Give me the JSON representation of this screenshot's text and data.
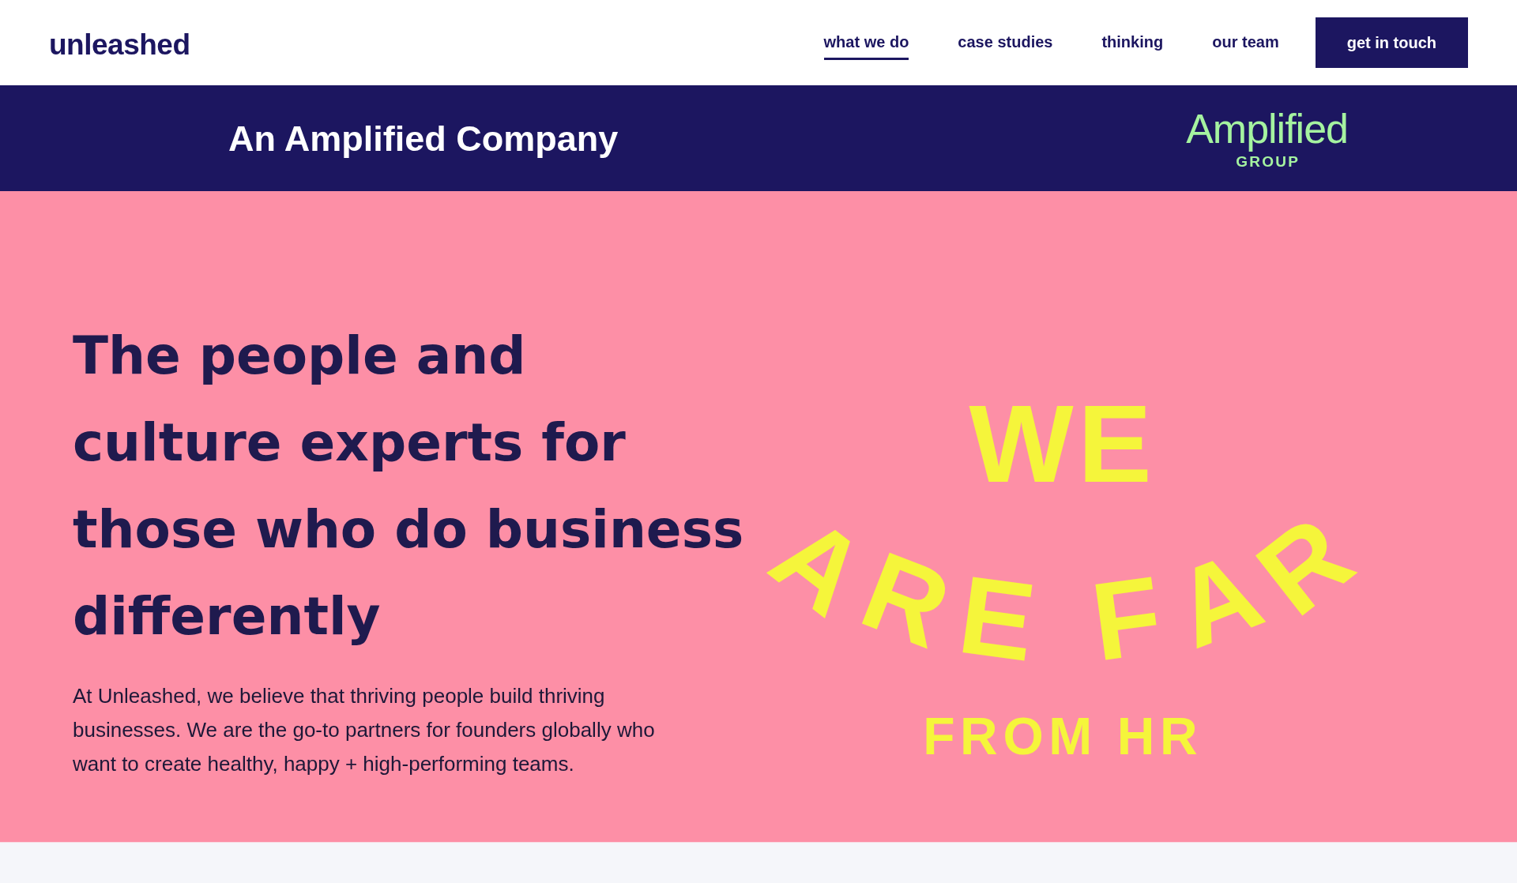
{
  "header": {
    "logo": "unleashed",
    "nav": [
      {
        "label": "what we do",
        "selected": true
      },
      {
        "label": "case studies",
        "selected": false
      },
      {
        "label": "thinking",
        "selected": false
      },
      {
        "label": "our team",
        "selected": false
      }
    ],
    "cta": "get in touch"
  },
  "banner": {
    "title": "An Amplified Company",
    "logo": {
      "name": "Amplified",
      "tagline": "GROUP"
    }
  },
  "hero": {
    "headline": "The people and culture experts for those who do business differently",
    "intro": "At Unleashed, we believe that thriving people build thriving businesses. We are the go-to partners for founders globally who want to create healthy, happy + high-performing teams.",
    "slogan": {
      "top": "WE",
      "arc": "ARE FAR",
      "bottom": "FROM HR"
    }
  }
}
